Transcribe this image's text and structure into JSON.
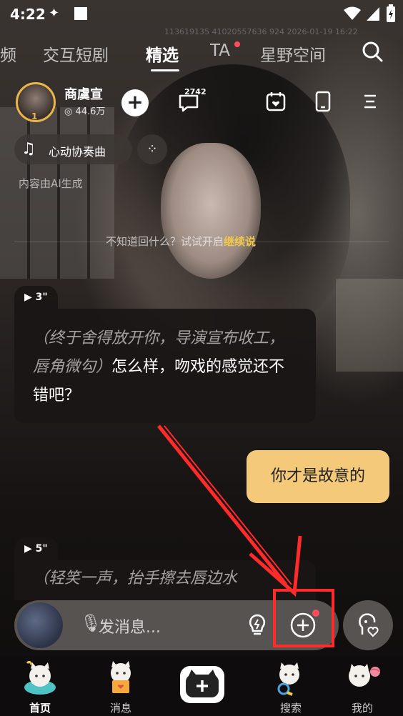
{
  "status_bar": {
    "time": "4:22"
  },
  "watermark": "113619135 41020557636 924 2026-01-19 16:22",
  "tabs": [
    {
      "label": "频"
    },
    {
      "label": "交互短剧"
    },
    {
      "label": "精选"
    },
    {
      "label": "TA"
    },
    {
      "label": "星野空间"
    }
  ],
  "profile": {
    "name": "商虞宣",
    "fans": "44.6万",
    "level": "1"
  },
  "top_icons": {
    "chat_count": "2742"
  },
  "music_chip": {
    "label": "心动协奏曲"
  },
  "ai_note": "内容由AI生成",
  "hint": {
    "prefix": "不知道回什么？试试开启",
    "highlight": "继续说"
  },
  "messages": [
    {
      "duration": "3\"",
      "action": "（终于舍得放开你，导演宣布收工，唇角微勾）",
      "text": "怎么样，吻戏的感觉还不错吧？"
    },
    {
      "user_text": "你才是故意的"
    },
    {
      "duration": "5\"",
      "action": "（轻笑一声，抬手擦去唇边水"
    }
  ],
  "input": {
    "placeholder": "发消息..."
  },
  "nav": [
    {
      "label": "首页"
    },
    {
      "label": "消息"
    },
    {
      "label": ""
    },
    {
      "label": "搜索"
    },
    {
      "label": "我的"
    }
  ],
  "colors": {
    "accent_gold": "#f0c84a",
    "user_bubble": "#f5c97a",
    "annotation_red": "#ff2a2a"
  }
}
